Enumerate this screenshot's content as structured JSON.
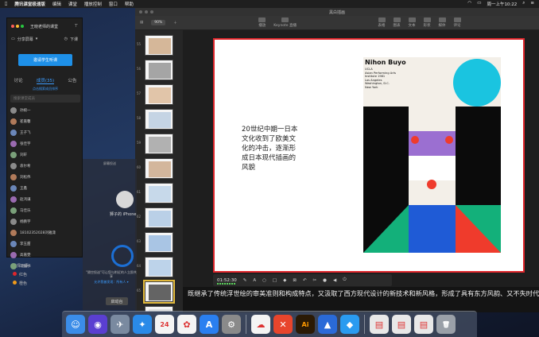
{
  "menubar": {
    "app": "腾讯课堂极速版",
    "items": [
      "编辑",
      "课堂",
      "播放控制",
      "窗口",
      "帮助"
    ],
    "clock": "周一上午10:22"
  },
  "keynote": {
    "title": "黑白插画",
    "zoom": "90%",
    "toolbar": [
      "播放",
      "Keynote 直播",
      "表格",
      "图表",
      "文本",
      "形状",
      "媒体",
      "评论"
    ],
    "thumb_numbers": [
      "55",
      "56",
      "57",
      "58",
      "59",
      "60",
      "61",
      "62",
      "63",
      "64",
      "65",
      "66"
    ]
  },
  "slide": {
    "text": "20世纪中期一日本文化收到了欧美文化的冲击，逐渐形成日本现代插画的风貌",
    "poster_title": "Nihon Buyo",
    "poster_lines": [
      "UCLA",
      "Asian Performing Arts",
      "Institute 1981",
      "Los Angeles",
      "Washington, D.C.",
      "New York"
    ]
  },
  "recorder": {
    "time": "01:52:30"
  },
  "caption": "既继承了传统浮世绘的审美准则和构成特点，又汲取了西方现代设计的新技术和新风格，形成了具有东方风韵、又不失时代感的艺术风格。",
  "panel": {
    "title": "王晓老师的课堂",
    "share": "分享屏幕",
    "leave": "下课",
    "invite": "邀请学生听课",
    "tabs": [
      "讨论",
      "成员(35)",
      "公告"
    ],
    "sub": "点击搜索成员排序",
    "search_placeholder": "搜索课堂成员",
    "members": [
      "孙婉一",
      "崔嘉馨",
      "王子飞",
      "张佳宇",
      "刘轩",
      "袁尔希",
      "刘松伟",
      "王鑫",
      "赵鸿谦",
      "马佳乐",
      "杨鹏宇",
      "18102352028刘雅潇",
      "李玉甜",
      "高嘉雯",
      "马振书"
    ],
    "below": [
      "选择元素",
      "红色",
      "橙色"
    ]
  },
  "behind": {
    "header": "屏幕投送",
    "phone": "狮子的 iPhone",
    "airdrop": "\"隔空投送\"可让您与附近的人立即共享",
    "link": "允许我被发现：所有人 ▾",
    "launch": "启动台"
  },
  "colors": {
    "accent": "#1e90e8",
    "slide_border": "#e0262c",
    "poster_purple": "#9b6fd1",
    "poster_cyan": "#1ac4e0",
    "poster_red": "#ef3b2c",
    "poster_green": "#13b07a",
    "poster_blue": "#1f5bd6"
  },
  "dock": [
    "finder-icon",
    "siri-icon",
    "launchpad-icon",
    "safari-icon",
    "calendar-icon",
    "photos-icon",
    "appstore-icon",
    "settings-icon",
    "baidu-cloud-icon",
    "xmind-icon",
    "illustrator-icon",
    "keynote-icon",
    "tencent-class-icon",
    "file-icon",
    "file-icon",
    "file-icon",
    "trash-icon"
  ]
}
